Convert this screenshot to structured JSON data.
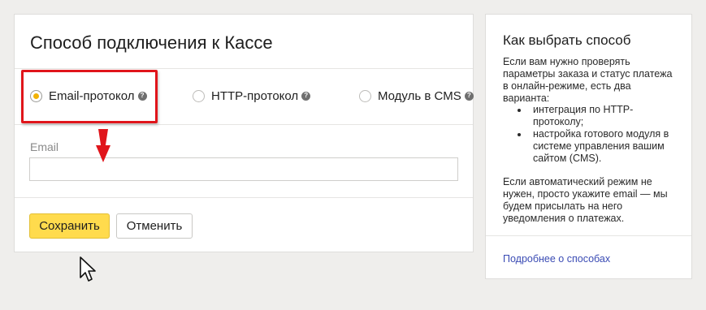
{
  "form": {
    "title": "Способ подключения к Кассе",
    "options": [
      {
        "label": "Email-протокол",
        "selected": true,
        "icon": "help-icon"
      },
      {
        "label": "HTTP-протокол",
        "selected": false,
        "icon": "help-icon"
      },
      {
        "label": "Модуль в CMS",
        "selected": false,
        "icon": "help-icon"
      }
    ],
    "email_label": "Email",
    "email_value": "",
    "save_label": "Сохранить",
    "cancel_label": "Отменить"
  },
  "help": {
    "title": "Как выбрать способ",
    "intro": "Если вам нужно проверять параметры заказа и статус платежа в онлайн-режиме, есть два варианта:",
    "items": [
      "интеграция по HTTP-протоколу;",
      "настройка готового модуля в системе управления вашим сайтом (CMS)."
    ],
    "outro": "Если автоматический режим не нужен, просто укажите email — мы будем присылать на него уведомления о платежах.",
    "link": "Подробнее о способах"
  },
  "annotations": {
    "highlight_color": "#e0151b",
    "arrow_icon": "down-arrow-icon",
    "cursor_icon": "mouse-pointer-icon"
  },
  "colors": {
    "accent_yellow": "#ffdb4d",
    "link_blue": "#3a4bb4",
    "background": "#efeeec"
  }
}
